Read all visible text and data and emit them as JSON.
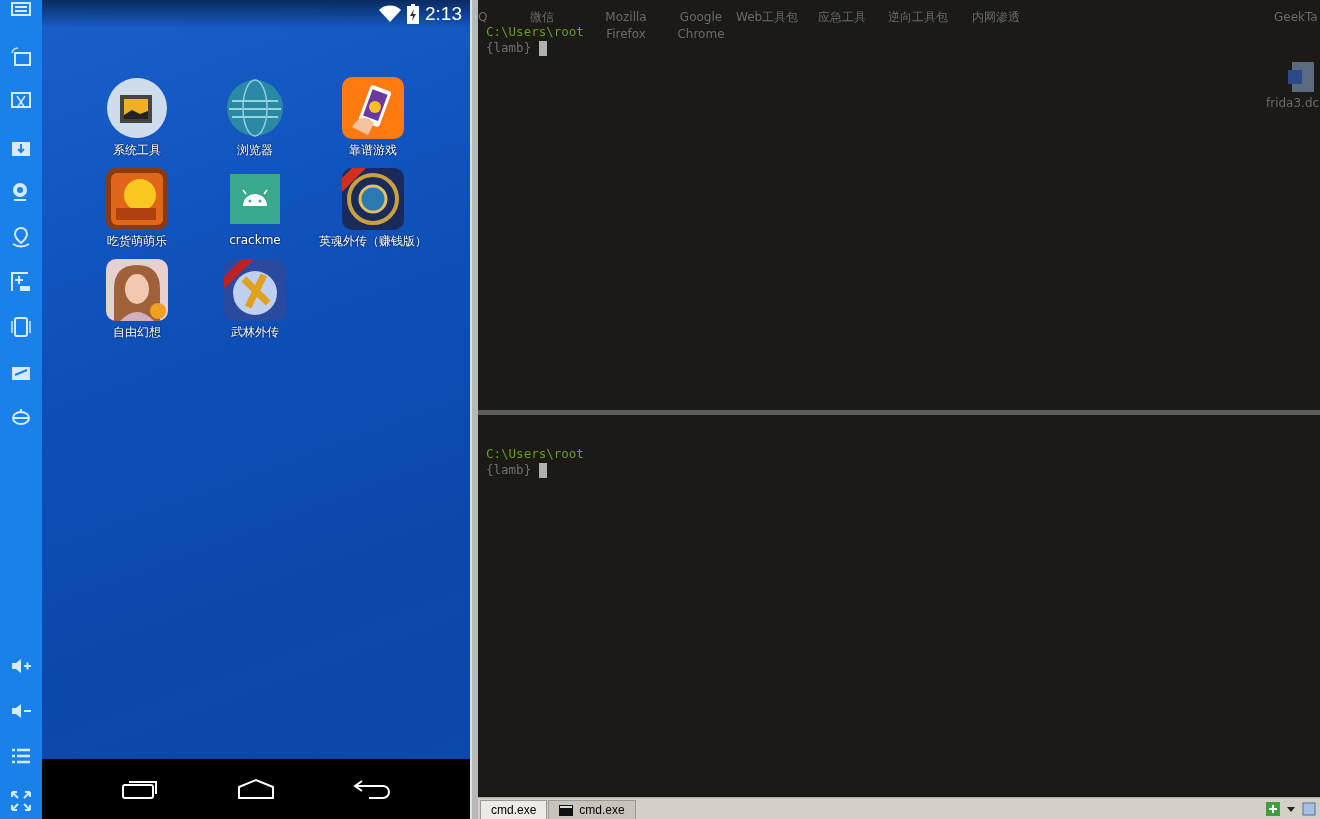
{
  "phone": {
    "status_bar": {
      "time": "2:13"
    },
    "apps": [
      {
        "label": "系统工具"
      },
      {
        "label": "浏览器"
      },
      {
        "label": "靠谱游戏"
      },
      {
        "label": "吃货萌萌乐"
      },
      {
        "label": "crackme"
      },
      {
        "label": "英魂外传（赚钱版）"
      },
      {
        "label": "自由幻想"
      },
      {
        "label": "武林外传"
      }
    ]
  },
  "desktop_icons": [
    {
      "label": "Q"
    },
    {
      "label": "微信"
    },
    {
      "label": "Mozilla Firefox"
    },
    {
      "label": "Google Chrome"
    },
    {
      "label": "Web工具包"
    },
    {
      "label": "应急工具"
    },
    {
      "label": "逆向工具包"
    },
    {
      "label": "内网渗透"
    },
    {
      "label": "GeekTa"
    },
    {
      "label": "frida3.dc"
    }
  ],
  "terminal": {
    "panes": [
      {
        "lines": [
          {
            "kind": "path",
            "text": "C:\\Users\\root"
          },
          {
            "kind": "prompt",
            "text": "{lamb}"
          }
        ]
      },
      {
        "lines": [
          {
            "kind": "path",
            "text": "C:\\Users\\root"
          },
          {
            "kind": "prompt",
            "text": "{lamb}"
          }
        ]
      }
    ],
    "tabs": [
      {
        "label": "cmd.exe",
        "selected": true
      },
      {
        "label": "cmd.exe",
        "selected": false
      }
    ]
  }
}
